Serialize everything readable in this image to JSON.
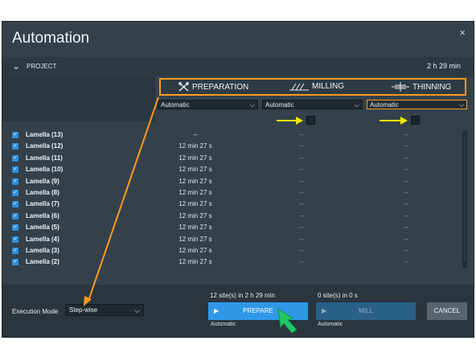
{
  "window": {
    "title": "Automation",
    "close_glyph": "×"
  },
  "project": {
    "label": "PROJECT",
    "total_time": "2 h 29 min"
  },
  "stages": [
    {
      "label": "PREPARATION",
      "icon": "preparation-icon"
    },
    {
      "label": "MILLING",
      "icon": "milling-icon"
    },
    {
      "label": "THINNING",
      "icon": "thinning-icon"
    }
  ],
  "dropdowns": [
    "Automatic",
    "Automatic",
    "Automatic"
  ],
  "rows": [
    {
      "name": "Lamella (13)",
      "prep": "--",
      "mill": "--",
      "thin": "--"
    },
    {
      "name": "Lamella (12)",
      "prep": "12 min 27 s",
      "mill": "--",
      "thin": "--"
    },
    {
      "name": "Lamella (11)",
      "prep": "12 min 27 s",
      "mill": "--",
      "thin": "--"
    },
    {
      "name": "Lamella (10)",
      "prep": "12 min 27 s",
      "mill": "--",
      "thin": "--"
    },
    {
      "name": "Lamella (9)",
      "prep": "12 min 27 s",
      "mill": "--",
      "thin": "--"
    },
    {
      "name": "Lamella (8)",
      "prep": "12 min 27 s",
      "mill": "--",
      "thin": "--"
    },
    {
      "name": "Lamella (7)",
      "prep": "12 min 27 s",
      "mill": "--",
      "thin": "--"
    },
    {
      "name": "Lamella (6)",
      "prep": "12 min 27 s",
      "mill": "--",
      "thin": "--"
    },
    {
      "name": "Lamella (5)",
      "prep": "12 min 27 s",
      "mill": "--",
      "thin": "--"
    },
    {
      "name": "Lamella (4)",
      "prep": "12 min 27 s",
      "mill": "--",
      "thin": "--"
    },
    {
      "name": "Lamella (3)",
      "prep": "12 min 27 s",
      "mill": "--",
      "thin": "--"
    },
    {
      "name": "Lamella (2)",
      "prep": "12 min 27 s",
      "mill": "--",
      "thin": "--"
    }
  ],
  "footer": {
    "exec_label": "Execution Mode",
    "exec_value": "Step-wise",
    "prep_summary": "12 site(s) in 2 h 29 min",
    "mill_summary": "0 site(s) in 0 s",
    "prepare_label": "PREPARE",
    "mill_label": "MILL",
    "cancel_label": "CANCEL",
    "prepare_sub": "Automatic",
    "mill_sub": "Automatic"
  },
  "colors": {
    "highlight": "#ff9a1f",
    "pointer_arrow": "#f2e600",
    "cursor_arrow": "#22c766",
    "accent": "#2f98e6"
  }
}
